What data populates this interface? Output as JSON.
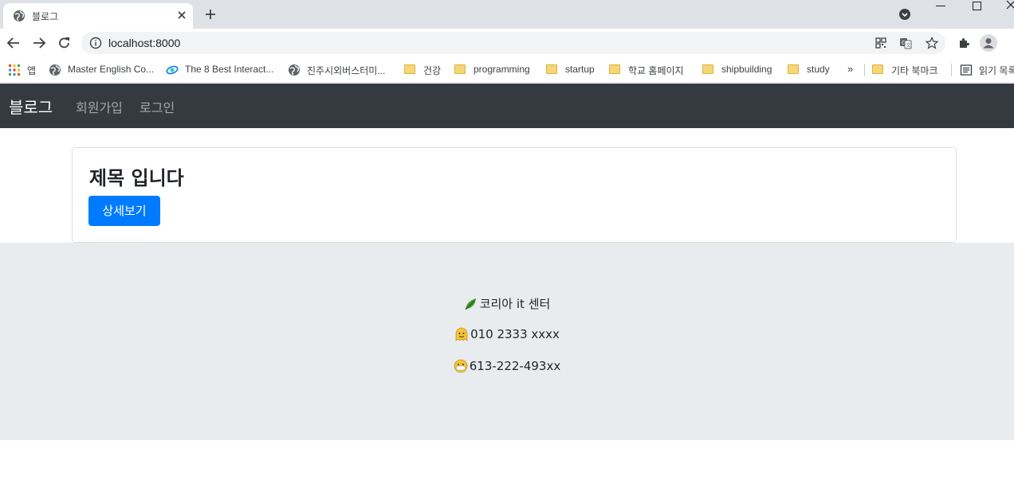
{
  "browser": {
    "tab_title": "블로그",
    "url": "localhost:8000",
    "bookmarks": [
      {
        "label": "앱",
        "icon": "apps-grid-icon"
      },
      {
        "label": "Master English Co...",
        "icon": "globe-icon"
      },
      {
        "label": "The 8 Best Interact...",
        "icon": "site-icon"
      },
      {
        "label": "진주시외버스터미...",
        "icon": "globe-icon"
      },
      {
        "label": "건강",
        "icon": "folder-icon"
      },
      {
        "label": "programming",
        "icon": "folder-icon"
      },
      {
        "label": "startup",
        "icon": "folder-icon"
      },
      {
        "label": "학교 홈페이지",
        "icon": "folder-icon"
      },
      {
        "label": "shipbuilding",
        "icon": "folder-icon"
      },
      {
        "label": "study",
        "icon": "folder-icon"
      }
    ],
    "overflow": "»",
    "other_bookmarks": "기타 북마크",
    "reading_list": "읽기 목록"
  },
  "navbar": {
    "brand": "블로그",
    "links": [
      "회원가입",
      "로그인"
    ]
  },
  "card": {
    "title": "제목 입니다",
    "button": "상세보기"
  },
  "footer": {
    "company": "코리아 it 센터",
    "phone": "010 2333 xxxx",
    "fax": "613-222-493xx"
  },
  "colors": {
    "navbar": "#343a40",
    "primary": "#007bff",
    "footer": "#e9ecef"
  }
}
